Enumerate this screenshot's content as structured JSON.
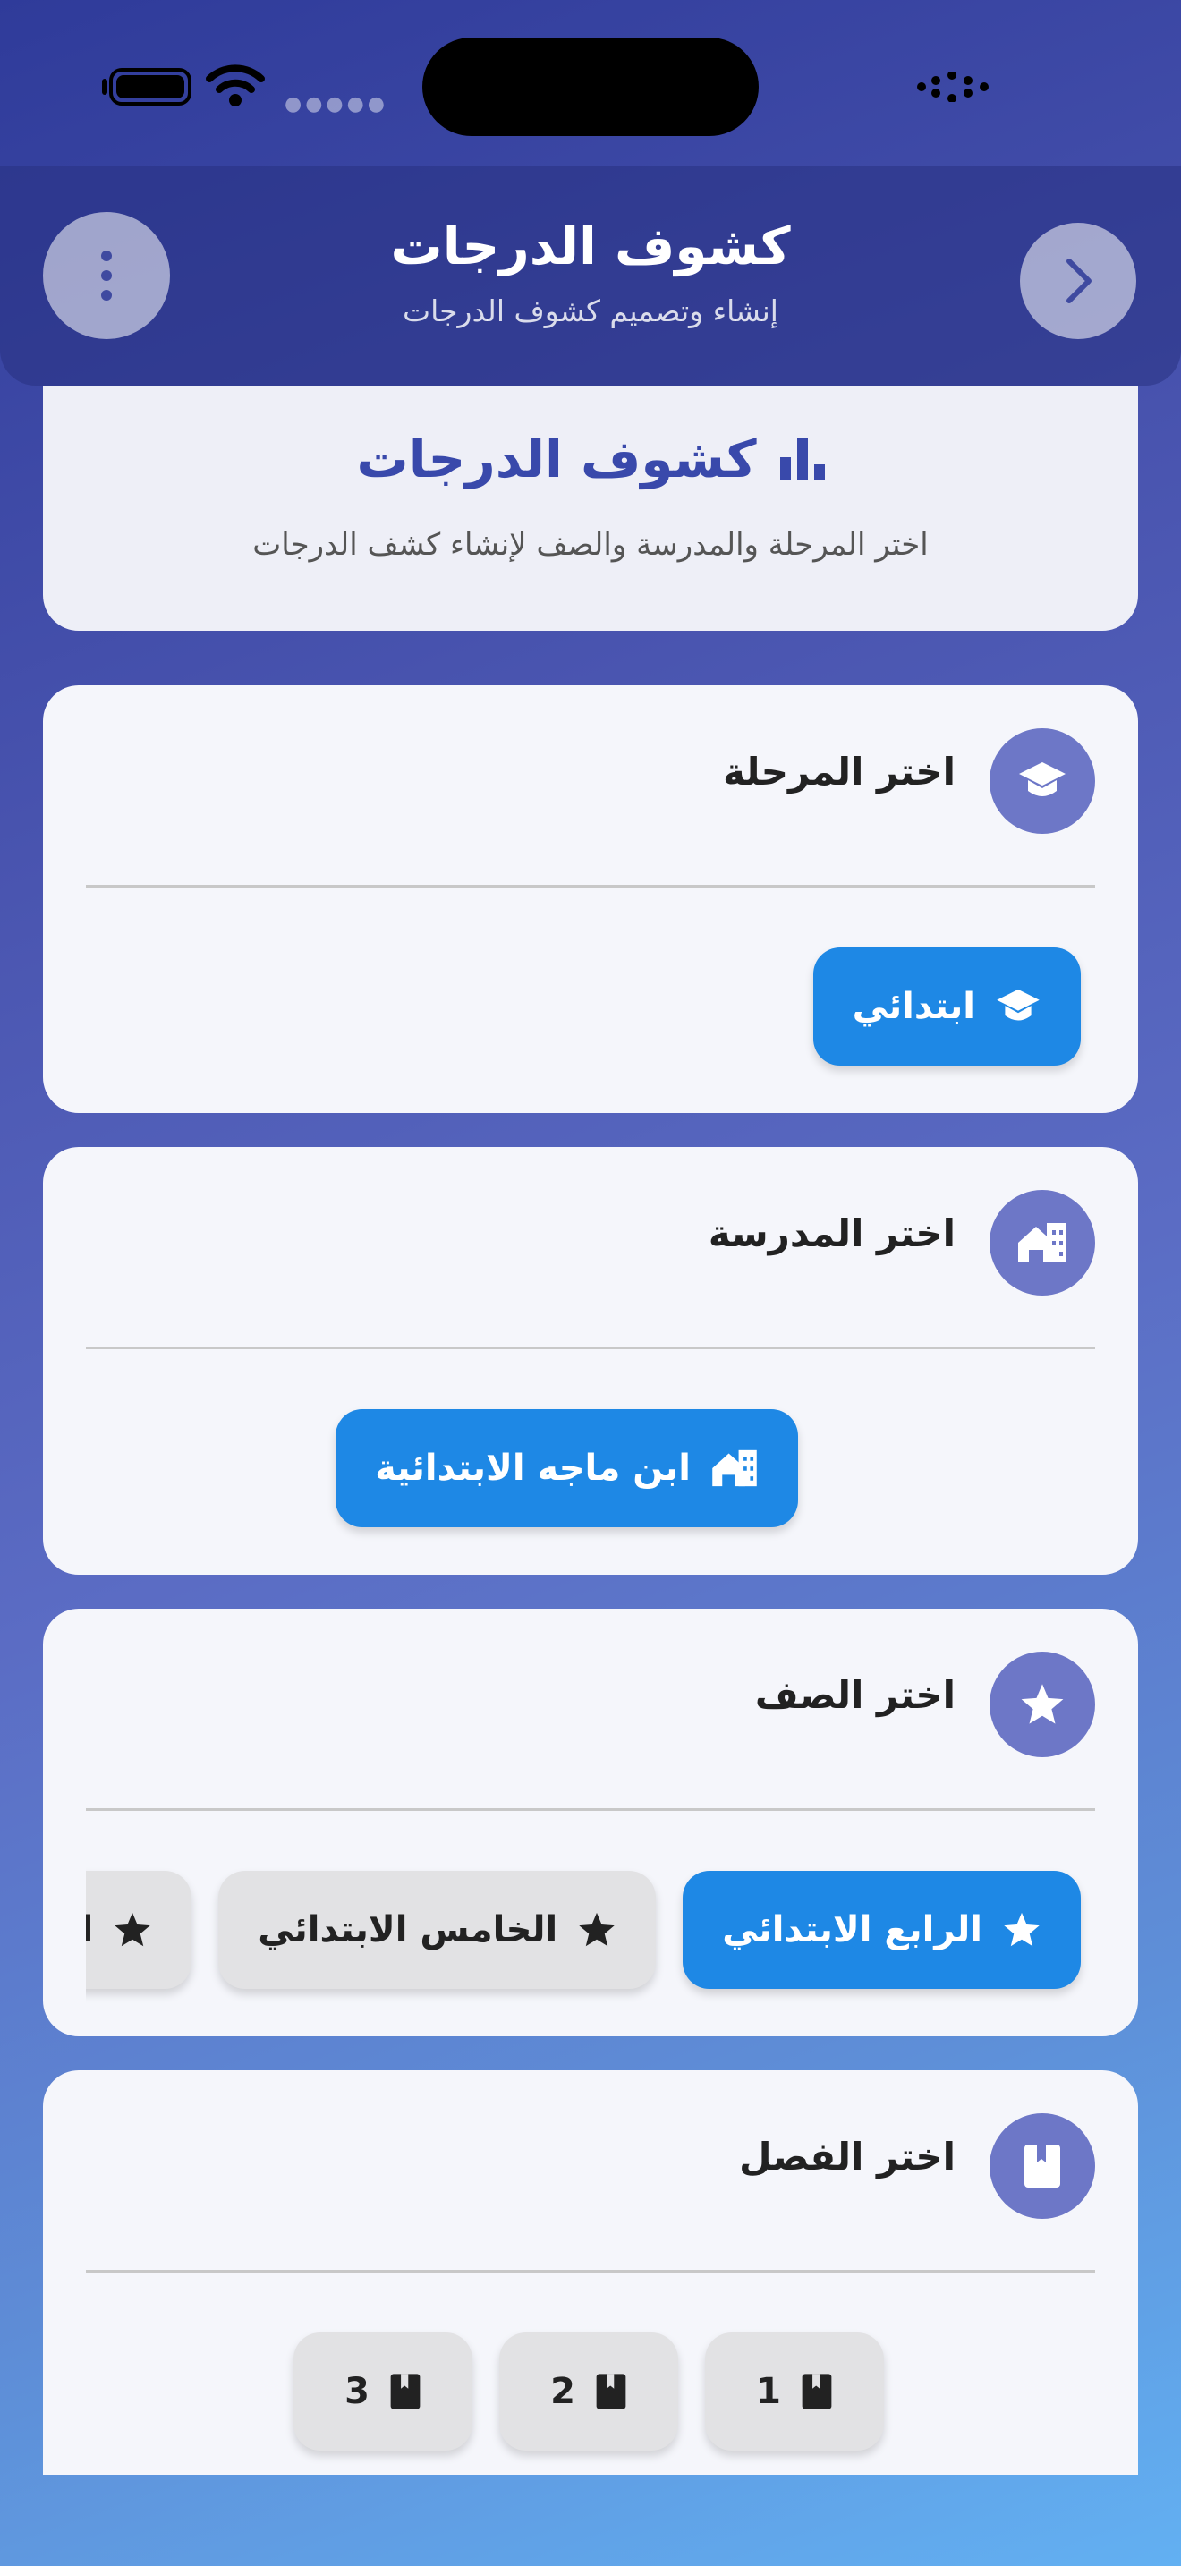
{
  "header": {
    "title": "كشوف الدرجات",
    "subtitle": "إنشاء وتصميم كشوف الدرجات"
  },
  "intro": {
    "title": "كشوف الدرجات",
    "description": "اختر المرحلة والمدرسة والصف لإنشاء كشف الدرجات"
  },
  "sections": {
    "stage": {
      "title": "اختر المرحلة",
      "options": [
        "ابتدائي"
      ],
      "selected": "ابتدائي"
    },
    "school": {
      "title": "اختر المدرسة",
      "options": [
        "ابن ماجه الابتدائية"
      ],
      "selected": "ابن ماجه الابتدائية"
    },
    "grade": {
      "title": "اختر الصف",
      "options": [
        "الرابع الابتدائي",
        "الخامس الابتدائي",
        "السادس الابتدائي"
      ],
      "selected": "الرابع الابتدائي"
    },
    "term": {
      "title": "اختر الفصل",
      "options": [
        "1",
        "2",
        "3"
      ]
    }
  },
  "colors": {
    "accent": "#1e88e5",
    "brand": "#3949ab",
    "icon_bg": "#6d77c7",
    "chip_inactive": "#e2e2e4"
  }
}
